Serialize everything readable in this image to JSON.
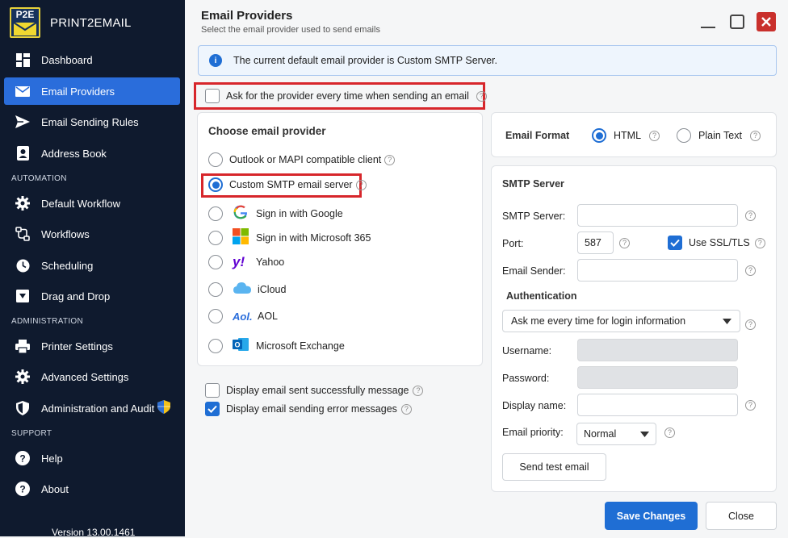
{
  "app": {
    "logo_text": "P2E",
    "name": "PRINT2EMAIL",
    "version": "Version 13.00.1461"
  },
  "sidebar": {
    "items": [
      {
        "label": "Dashboard",
        "icon": "dashboard-icon"
      },
      {
        "label": "Email Providers",
        "icon": "envelope-icon",
        "active": true
      },
      {
        "label": "Email Sending Rules",
        "icon": "send-icon"
      },
      {
        "label": "Address Book",
        "icon": "contact-icon"
      },
      {
        "label": "Default Workflow",
        "icon": "gear-icon"
      },
      {
        "label": "Workflows",
        "icon": "workflow-icon"
      },
      {
        "label": "Scheduling",
        "icon": "clock-icon"
      },
      {
        "label": "Drag and Drop",
        "icon": "drag-drop-icon"
      },
      {
        "label": "Printer Settings",
        "icon": "printer-icon"
      },
      {
        "label": "Advanced Settings",
        "icon": "gear-icon"
      },
      {
        "label": "Administration and Audit",
        "icon": "shield-icon"
      },
      {
        "label": "Help",
        "icon": "help-icon"
      },
      {
        "label": "About",
        "icon": "about-icon"
      }
    ],
    "sections": {
      "automation": "AUTOMATION",
      "administration": "ADMINISTRATION",
      "support": "SUPPORT"
    }
  },
  "header": {
    "title": "Email Providers",
    "subtitle": "Select the email provider used to send emails"
  },
  "info_banner": "The current default email provider is Custom SMTP Server.",
  "ask_provider": {
    "label": "Ask for the provider every time when sending an email",
    "checked": false
  },
  "providers": {
    "title": "Choose email provider",
    "options": [
      {
        "label": "Outlook or MAPI compatible client",
        "selected": false
      },
      {
        "label": "Custom SMTP email server",
        "selected": true
      },
      {
        "label": "Sign in with Google",
        "icon": "google-icon"
      },
      {
        "label": "Sign in with Microsoft 365",
        "icon": "microsoft-icon"
      },
      {
        "label": "Yahoo",
        "icon": "yahoo-icon"
      },
      {
        "label": "iCloud",
        "icon": "icloud-icon"
      },
      {
        "label": "AOL",
        "icon": "aol-icon"
      },
      {
        "label": "Microsoft Exchange",
        "icon": "exchange-icon"
      }
    ]
  },
  "display_options": {
    "success_label": "Display email sent successfully message",
    "success_checked": false,
    "error_label": "Display email sending error messages",
    "error_checked": true
  },
  "format": {
    "label": "Email Format",
    "html": "HTML",
    "plain": "Plain Text",
    "selected": "HTML"
  },
  "smtp": {
    "title": "SMTP Server",
    "server_label": "SMTP Server:",
    "server_value": "",
    "port_label": "Port:",
    "port_value": "587",
    "ssl_label": "Use SSL/TLS",
    "ssl_checked": true,
    "sender_label": "Email Sender:",
    "sender_value": "",
    "auth_title": "Authentication",
    "auth_mode": "Ask me every time for login information",
    "username_label": "Username:",
    "password_label": "Password:",
    "display_name_label": "Display name:",
    "priority_label": "Email priority:",
    "priority_value": "Normal",
    "test_button": "Send test email"
  },
  "footer": {
    "save": "Save Changes",
    "close": "Close"
  },
  "colors": {
    "accent": "#2a6ddb",
    "sidebar_bg": "#0f1a2e",
    "highlight_red": "#d7262b"
  }
}
